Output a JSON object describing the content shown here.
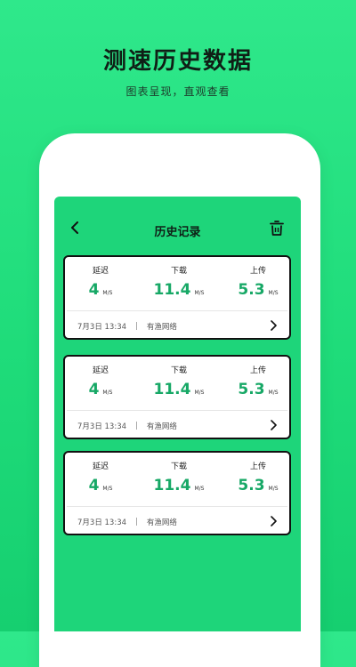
{
  "promo": {
    "title": "测速历史数据",
    "subtitle": "图表呈现，直观查看"
  },
  "nav": {
    "title": "历史记录"
  },
  "labels": {
    "latency": "延迟",
    "download": "下载",
    "upload": "上传"
  },
  "records": [
    {
      "latency": "4",
      "latency_unit": "M/S",
      "download": "11.4",
      "download_unit": "M/S",
      "upload": "5.3",
      "upload_unit": "M/S",
      "datetime": "7月3日 13:34",
      "separator": "|",
      "network": "有渔网络"
    },
    {
      "latency": "4",
      "latency_unit": "M/S",
      "download": "11.4",
      "download_unit": "M/S",
      "upload": "5.3",
      "upload_unit": "M/S",
      "datetime": "7月3日 13:34",
      "separator": "|",
      "network": "有渔网络"
    },
    {
      "latency": "4",
      "latency_unit": "M/S",
      "download": "11.4",
      "download_unit": "M/S",
      "upload": "5.3",
      "upload_unit": "M/S",
      "datetime": "7月3日 13:34",
      "separator": "|",
      "network": "有渔网络"
    }
  ],
  "colors": {
    "background": "#1fdc7a",
    "value_green": "#17a866",
    "card_border": "#111111"
  },
  "icons": {
    "back": "chevron-left-icon",
    "delete": "trash-icon",
    "detail": "chevron-right-icon"
  }
}
